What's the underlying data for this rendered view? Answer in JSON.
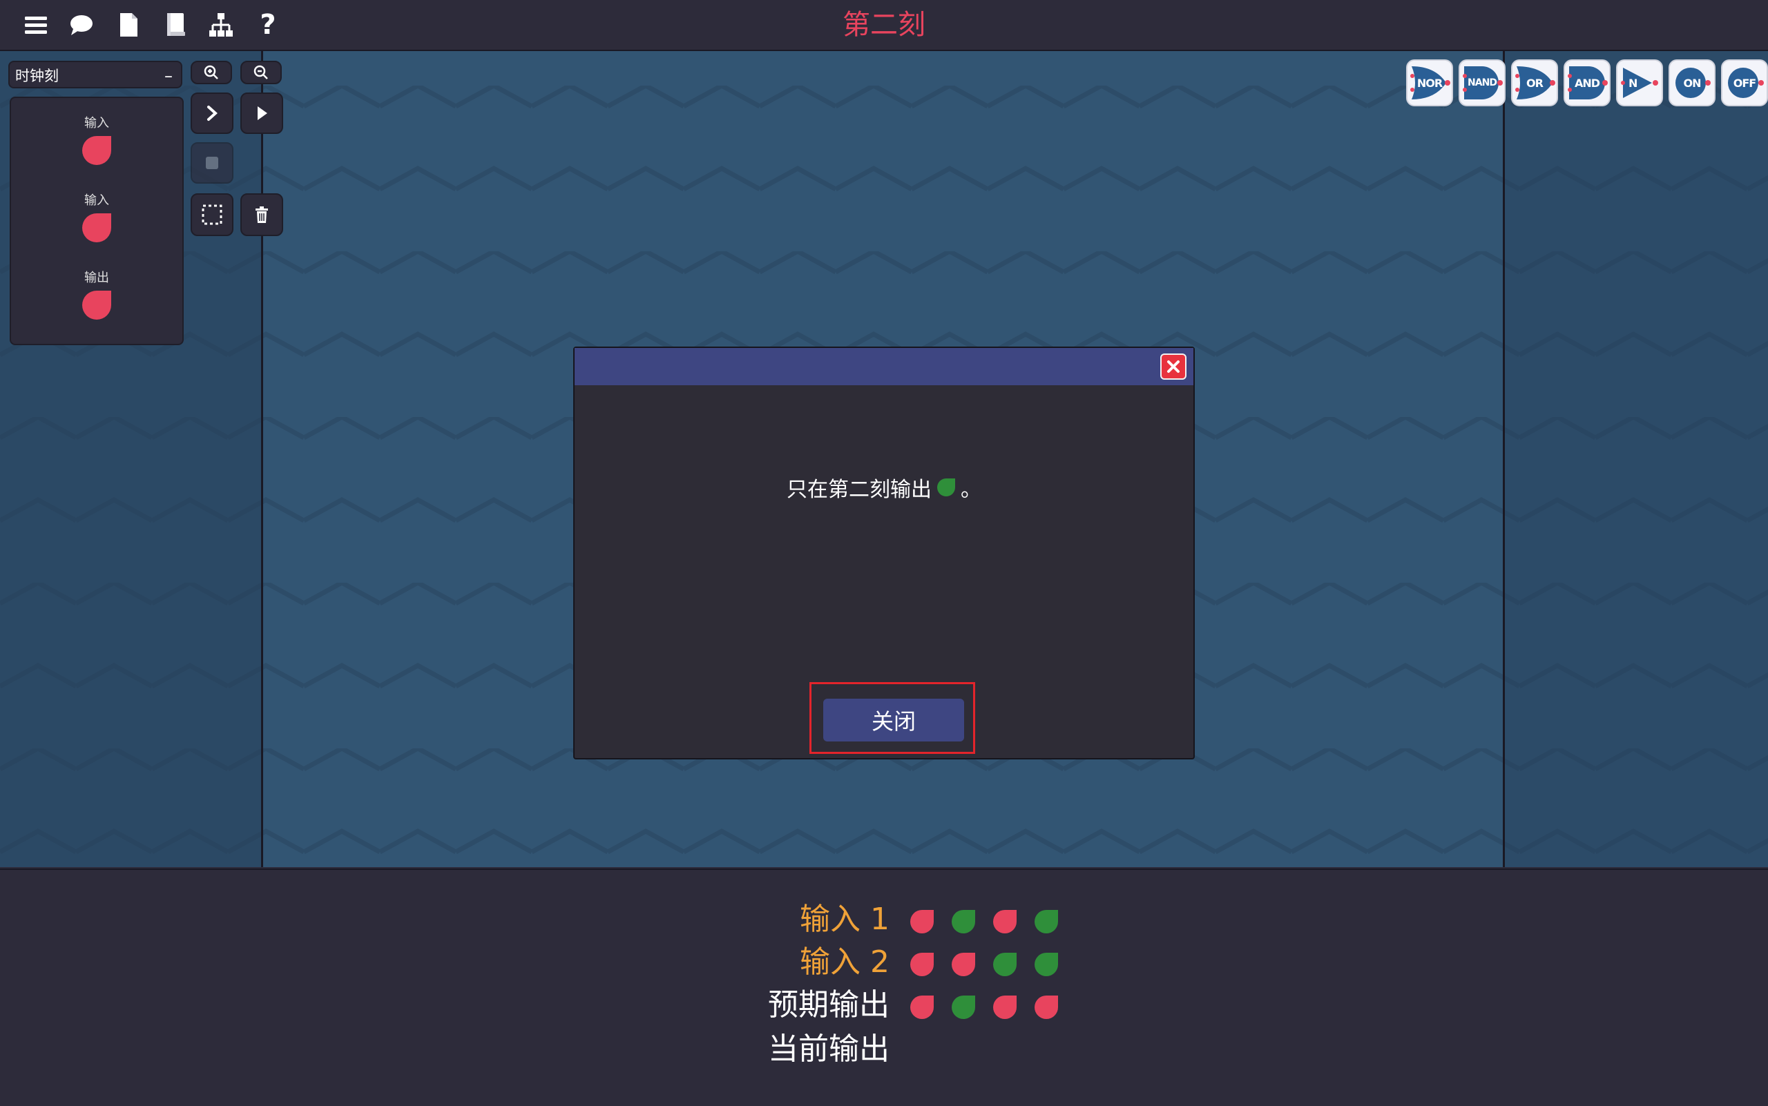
{
  "window": {
    "title": "第二刻"
  },
  "toolbar": {
    "icons": [
      "menu-icon",
      "chat-icon",
      "file-icon",
      "book-icon",
      "hierarchy-icon",
      "help-icon"
    ],
    "help_label": "?"
  },
  "left_panel": {
    "component_select": {
      "value": "时钟刻",
      "collapse_label": "–"
    },
    "io_items": [
      {
        "label": "输入",
        "state": "off"
      },
      {
        "label": "输入",
        "state": "off"
      },
      {
        "label": "输出",
        "state": "off"
      }
    ]
  },
  "tools": [
    "zoom-in-icon",
    "zoom-out-icon",
    "step-icon",
    "play-icon",
    "stop-icon",
    "select-icon",
    "trash-icon"
  ],
  "gate_palette": [
    "NOR",
    "NAND",
    "OR",
    "AND",
    "N",
    "ON",
    "OFF"
  ],
  "dialog": {
    "message_prefix": "只在第二刻输出",
    "message_suffix": "。",
    "message_icon_state": "on",
    "close_button_label": "关闭"
  },
  "truth_table": {
    "rows": [
      {
        "label": "输入 1",
        "values": [
          "off",
          "on",
          "off",
          "on"
        ]
      },
      {
        "label": "输入 2",
        "values": [
          "off",
          "off",
          "on",
          "on"
        ]
      },
      {
        "label": "预期输出",
        "values": [
          "off",
          "on",
          "off",
          "off"
        ]
      },
      {
        "label": "当前输出",
        "values": []
      }
    ]
  },
  "colors": {
    "title": "#e8445e",
    "signal_on": "#2f8f3a",
    "signal_off": "#e8445e",
    "input_label": "#f0a238",
    "output_label": "#ffffff",
    "accent": "#3e4682"
  }
}
